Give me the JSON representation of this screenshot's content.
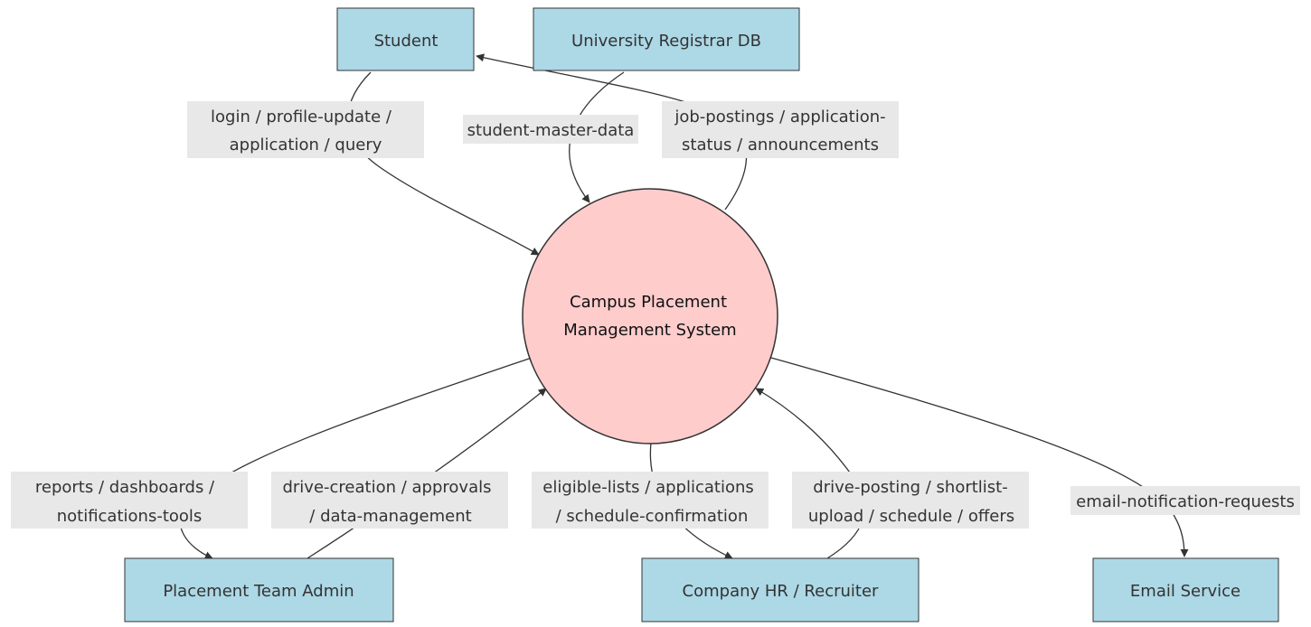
{
  "nodes": {
    "student": "Student",
    "registrar": "University Registrar DB",
    "system_line1": "Campus Placement",
    "system_line2": "Management System",
    "placement_admin": "Placement Team Admin",
    "company_hr": "Company HR / Recruiter",
    "email_service": "Email Service"
  },
  "edges": {
    "student_to_system": [
      "login / profile-update /",
      "application / query"
    ],
    "registrar_to_system": [
      "student-master-data"
    ],
    "system_to_student": [
      "job-postings / application-",
      "status / announcements"
    ],
    "system_to_admin": [
      "reports / dashboards /",
      "notifications-tools"
    ],
    "admin_to_system": [
      "drive-creation / approvals",
      "/ data-management"
    ],
    "system_to_hr": [
      "eligible-lists / applications",
      "/ schedule-confirmation"
    ],
    "hr_to_system": [
      "drive-posting / shortlist-",
      "upload / schedule / offers"
    ],
    "system_to_email": [
      "email-notification-requests"
    ]
  },
  "colors": {
    "external_entity": "#add8e6",
    "system": "#ffcccc",
    "label_background": "#e8e8e8",
    "stroke": "#333333"
  }
}
